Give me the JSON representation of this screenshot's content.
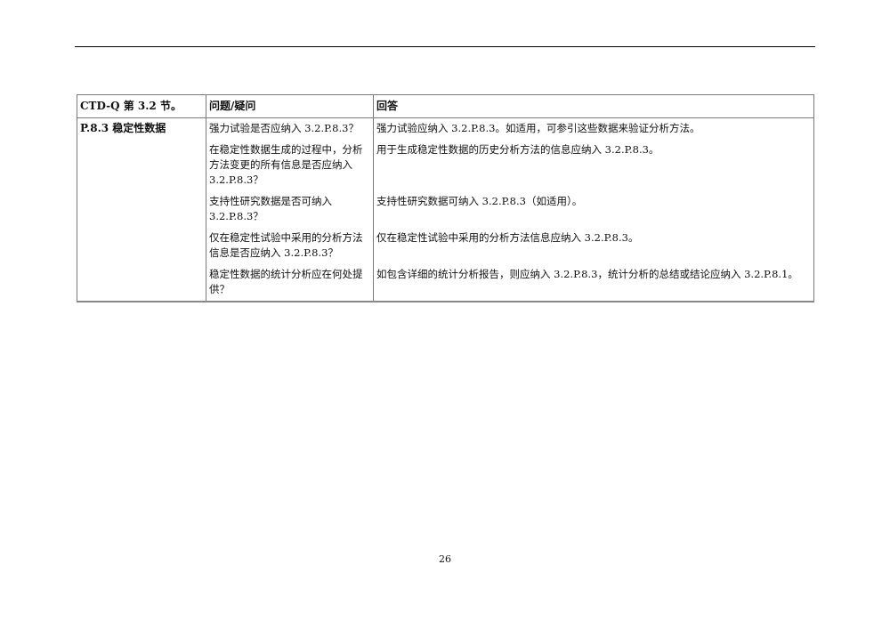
{
  "table": {
    "headers": {
      "section": "CTD-Q 第 3.2 节。",
      "question": "问题/疑问",
      "answer": "回答"
    },
    "section_label": "P.8.3 稳定性数据",
    "rows": [
      {
        "question": "强力试验是否应纳入 3.2.P.8.3？",
        "answer": "强力试验应纳入 3.2.P.8.3。如适用，可参引这些数据来验证分析方法。"
      },
      {
        "question": "在稳定性数据生成的过程中，分析方法变更的所有信息是否应纳入 3.2.P.8.3？",
        "answer": "用于生成稳定性数据的历史分析方法的信息应纳入 3.2.P.8.3。"
      },
      {
        "question": "支持性研究数据是否可纳入 3.2.P.8.3？",
        "answer": "支持性研究数据可纳入 3.2.P.8.3（如适用）。"
      },
      {
        "question": "仅在稳定性试验中采用的分析方法信息是否应纳入 3.2.P.8.3？",
        "answer": "仅在稳定性试验中采用的分析方法信息应纳入 3.2.P.8.3。"
      },
      {
        "question": "稳定性数据的统计分析应在何处提供？",
        "answer": "如包含详细的统计分析报告，则应纳入 3.2.P.8.3，统计分析的总结或结论应纳入 3.2.P.8.1。"
      }
    ]
  },
  "page_number": "26"
}
